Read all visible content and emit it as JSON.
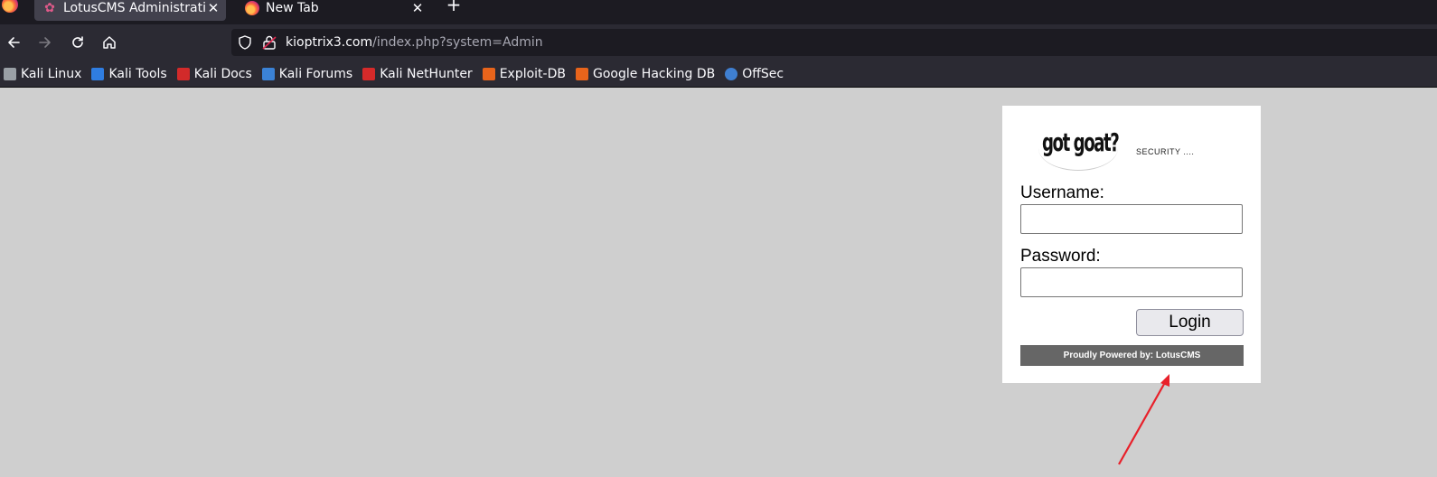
{
  "browser": {
    "tabs": [
      {
        "title": "LotusCMS Administration",
        "close": "✕",
        "active": true
      },
      {
        "title": "New Tab",
        "close": "✕",
        "active": false
      }
    ],
    "new_tab": "+",
    "url_host": "kioptrix3.com",
    "url_path": "/index.php?system=Admin",
    "bookmarks": [
      {
        "label": "Kali Linux",
        "icon": "kali-dragon-icon",
        "color": "#9aa0a6"
      },
      {
        "label": "Kali Tools",
        "icon": "kali-tools-icon",
        "color": "#2f7de1"
      },
      {
        "label": "Kali Docs",
        "icon": "kali-docs-icon",
        "color": "#d22a2a"
      },
      {
        "label": "Kali Forums",
        "icon": "kali-forums-icon",
        "color": "#3b82d6"
      },
      {
        "label": "Kali NetHunter",
        "icon": "nethunter-icon",
        "color": "#d62a2a"
      },
      {
        "label": "Exploit-DB",
        "icon": "exploit-db-icon",
        "color": "#e8641b"
      },
      {
        "label": "Google Hacking DB",
        "icon": "ghdb-icon",
        "color": "#e8641b"
      },
      {
        "label": "OffSec",
        "icon": "offsec-icon",
        "color": "#3f7fd1"
      }
    ]
  },
  "login": {
    "logo_text": "got goat?",
    "tagline": "SECURITY ....",
    "username_label": "Username:",
    "username_value": "",
    "password_label": "Password:",
    "password_value": "",
    "submit_label": "Login",
    "footer": "Proudly Powered by: LotusCMS"
  },
  "colors": {
    "page_background": "#cfcfcf",
    "annotation_arrow": "#e8202a"
  }
}
